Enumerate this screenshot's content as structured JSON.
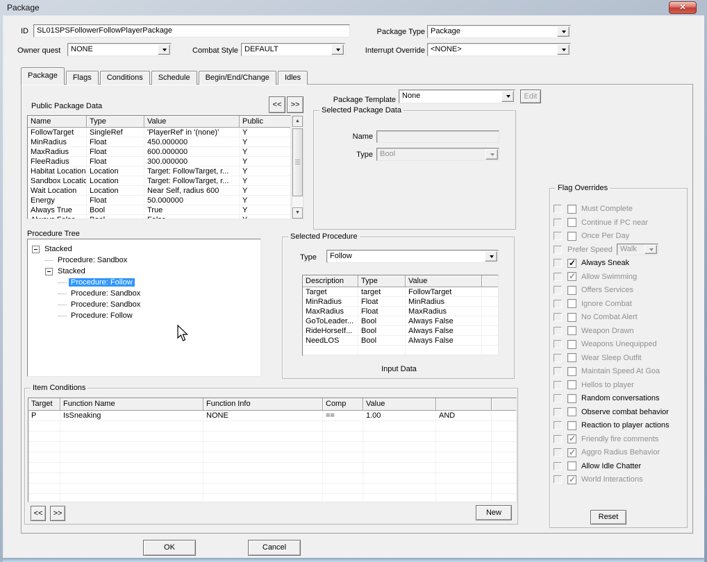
{
  "window": {
    "title": "Package",
    "close_glyph": "✕"
  },
  "form": {
    "id_label": "ID",
    "id_value": "SL01SPSFollowerFollowPlayerPackage",
    "owner_quest_label": "Owner quest",
    "owner_quest_value": "NONE",
    "combat_style_label": "Combat Style",
    "combat_style_value": "DEFAULT",
    "package_type_label": "Package Type",
    "package_type_value": "Package",
    "interrupt_override_label": "Interrupt Override",
    "interrupt_override_value": "<NONE>"
  },
  "tabs": [
    {
      "label": "Package",
      "selected": true
    },
    {
      "label": "Flags",
      "selected": false
    },
    {
      "label": "Conditions",
      "selected": false
    },
    {
      "label": "Schedule",
      "selected": false
    },
    {
      "label": "Begin/End/Change",
      "selected": false
    },
    {
      "label": "Idles",
      "selected": false
    }
  ],
  "nav": {
    "back_label": "<<",
    "forward_label": ">>"
  },
  "public_package_data": {
    "title": "Public Package Data",
    "columns": [
      "Name",
      "Type",
      "Value",
      "Public"
    ],
    "rows": [
      [
        "FollowTarget",
        "SingleRef",
        "'PlayerRef' in '(none)'",
        "Y"
      ],
      [
        "MinRadius",
        "Float",
        "450.000000",
        "Y"
      ],
      [
        "MaxRadius",
        "Float",
        "600.000000",
        "Y"
      ],
      [
        "FleeRadius",
        "Float",
        "300.000000",
        "Y"
      ],
      [
        "Habitat Location",
        "Location",
        "Target: FollowTarget, r...",
        "Y"
      ],
      [
        "Sandbox Location",
        "Location",
        "Target: FollowTarget, r...",
        "Y"
      ],
      [
        "Wait Location",
        "Location",
        "Near Self, radius 600",
        "Y"
      ],
      [
        "Energy",
        "Float",
        "50.000000",
        "Y"
      ],
      [
        "Always True",
        "Bool",
        "True",
        "Y"
      ],
      [
        "Always False",
        "Bool",
        "False",
        "Y"
      ]
    ]
  },
  "package_template": {
    "label": "Package Template",
    "value": "None",
    "edit_label": "Edit"
  },
  "selected_package_data": {
    "title": "Selected Package Data",
    "name_label": "Name",
    "name_value": "",
    "type_label": "Type",
    "type_value": "Bool"
  },
  "procedure_tree": {
    "title": "Procedure Tree",
    "nodes": [
      {
        "label": "Stacked",
        "depth": 0,
        "expander": true,
        "selected": false
      },
      {
        "label": "Procedure: Sandbox",
        "depth": 1,
        "expander": false,
        "selected": false
      },
      {
        "label": "Stacked",
        "depth": 1,
        "expander": true,
        "selected": false
      },
      {
        "label": "Procedure: Follow",
        "depth": 2,
        "expander": false,
        "selected": true
      },
      {
        "label": "Procedure: Sandbox",
        "depth": 2,
        "expander": false,
        "selected": false
      },
      {
        "label": "Procedure: Sandbox",
        "depth": 2,
        "expander": false,
        "selected": false
      },
      {
        "label": "Procedure: Follow",
        "depth": 2,
        "expander": false,
        "selected": false
      }
    ]
  },
  "selected_procedure": {
    "title": "Selected Procedure",
    "type_label": "Type",
    "type_value": "Follow",
    "columns": [
      "Description",
      "Type",
      "Value",
      ""
    ],
    "rows": [
      [
        "Target",
        "target",
        "FollowTarget"
      ],
      [
        "MinRadius",
        "Float",
        "MinRadius"
      ],
      [
        "MaxRadius",
        "Float",
        "MaxRadius"
      ],
      [
        "GoToLeader...",
        "Bool",
        "Always False"
      ],
      [
        "RideHorseIf...",
        "Bool",
        "Always False"
      ],
      [
        "NeedLOS",
        "Bool",
        "Always False"
      ]
    ],
    "footer_label": "Input Data"
  },
  "flag_overrides": {
    "title": "Flag Overrides",
    "reset_label": "Reset",
    "items": [
      {
        "label": "Must Complete",
        "checked": false,
        "enabled": false,
        "control": "checkbox"
      },
      {
        "label": "Continue if PC near",
        "checked": false,
        "enabled": false,
        "control": "checkbox"
      },
      {
        "label": "Once Per Day",
        "checked": false,
        "enabled": false,
        "control": "checkbox"
      },
      {
        "label": "Prefer Speed",
        "checked": false,
        "enabled": false,
        "control": "dropdown",
        "value": "Walk"
      },
      {
        "label": "Always Sneak",
        "checked": true,
        "enabled": true,
        "control": "checkbox"
      },
      {
        "label": "Allow Swimming",
        "checked": true,
        "enabled": false,
        "control": "checkbox"
      },
      {
        "label": "Offers Services",
        "checked": false,
        "enabled": false,
        "control": "checkbox"
      },
      {
        "label": "Ignore Combat",
        "checked": false,
        "enabled": false,
        "control": "checkbox"
      },
      {
        "label": "No Combat Alert",
        "checked": false,
        "enabled": false,
        "control": "checkbox"
      },
      {
        "label": "Weapon Drawn",
        "checked": false,
        "enabled": false,
        "control": "checkbox"
      },
      {
        "label": "Weapons Unequipped",
        "checked": false,
        "enabled": false,
        "control": "checkbox"
      },
      {
        "label": "Wear Sleep Outfit",
        "checked": false,
        "enabled": false,
        "control": "checkbox"
      },
      {
        "label": "Maintain Speed At Goa",
        "checked": false,
        "enabled": false,
        "control": "checkbox"
      },
      {
        "label": "Hellos to player",
        "checked": false,
        "enabled": false,
        "control": "checkbox"
      },
      {
        "label": "Random conversations",
        "checked": false,
        "enabled": true,
        "control": "checkbox"
      },
      {
        "label": "Observe combat behavior",
        "checked": false,
        "enabled": true,
        "control": "checkbox"
      },
      {
        "label": "Reaction to player actions",
        "checked": false,
        "enabled": true,
        "control": "checkbox"
      },
      {
        "label": "Friendly fire comments",
        "checked": true,
        "enabled": false,
        "control": "checkbox"
      },
      {
        "label": "Aggro Radius Behavior",
        "checked": true,
        "enabled": false,
        "control": "checkbox"
      },
      {
        "label": "Allow Idle Chatter",
        "checked": false,
        "enabled": true,
        "control": "checkbox"
      },
      {
        "label": "World Interactions",
        "checked": true,
        "enabled": false,
        "control": "checkbox"
      }
    ]
  },
  "item_conditions": {
    "title": "Item Conditions",
    "columns": [
      "Target",
      "Function Name",
      "Function Info",
      "Comp",
      "Value",
      "",
      ""
    ],
    "rows": [
      [
        "P",
        "IsSneaking",
        "NONE",
        "==",
        "1.00",
        "AND",
        ""
      ]
    ],
    "back_label": "<<",
    "forward_label": ">>",
    "new_label": "New"
  },
  "footer": {
    "ok_label": "OK",
    "cancel_label": "Cancel"
  },
  "icons": {
    "scroll_up": "▲",
    "scroll_down": "▼"
  },
  "colors": {
    "selection": "#2f96ff",
    "close_red": "#c94f43",
    "dialog_bg": "#f0f0f0"
  }
}
